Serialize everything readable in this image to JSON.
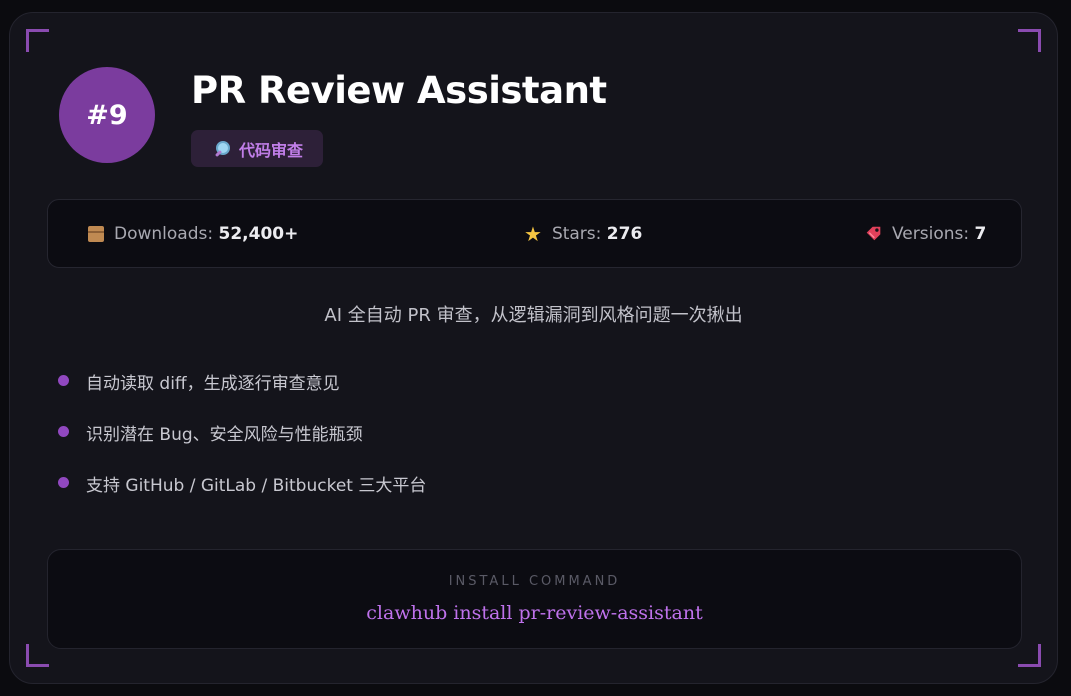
{
  "skill": {
    "rank": "#9",
    "title": "PR Review Assistant",
    "category": "代码审查",
    "category_icon": "magnifier-icon"
  },
  "stats": {
    "downloads": {
      "label": "Downloads:",
      "value": "52,400+",
      "icon": "package-icon"
    },
    "stars": {
      "label": "Stars:",
      "value": "276",
      "icon": "star-icon"
    },
    "versions": {
      "label": "Versions:",
      "value": "7",
      "icon": "tag-icon"
    }
  },
  "description": "AI 全自动 PR 审查，从逻辑漏洞到风格问题一次揪出",
  "features": [
    "自动读取 diff，生成逐行审查意见",
    "识别潜在 Bug、安全风险与性能瓶颈",
    "支持 GitHub / GitLab / Bitbucket 三大平台"
  ],
  "install": {
    "label": "INSTALL COMMAND",
    "command": "clawhub install pr-review-assistant"
  },
  "colors": {
    "accent": "#7b3c9e",
    "accent_text": "#bf72ec",
    "background": "#14141b",
    "star": "#f5c542"
  }
}
